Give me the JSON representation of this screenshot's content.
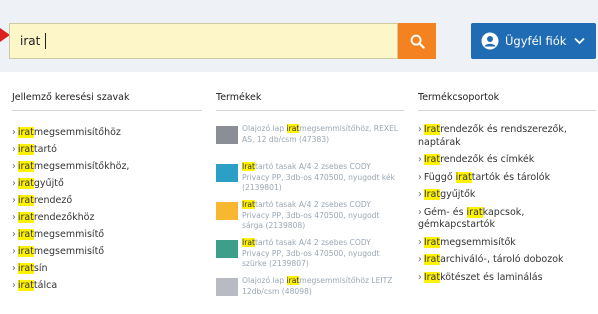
{
  "header": {
    "search_value": "irat",
    "account_label": "Ügyfél fiók",
    "colors": {
      "search_bg": "#fdf6c8",
      "search_button": "#f58220",
      "account_button": "#1f6cb5",
      "highlight": "#fff200"
    }
  },
  "columns": {
    "keywords_title": "Jellemző keresési szavak",
    "products_title": "Termékek",
    "categories_title": "Termékcsoportok"
  },
  "keywords": [
    {
      "pre": "›",
      "hl": "irat",
      "rest": "megsemmisítőhöz"
    },
    {
      "pre": "›",
      "hl": "irat",
      "rest": "tartó"
    },
    {
      "pre": "›",
      "hl": "irat",
      "rest": "megsemmisítőkhöz,"
    },
    {
      "pre": "›",
      "hl": "irat",
      "rest": "gyűjtő"
    },
    {
      "pre": "›",
      "hl": "irat",
      "rest": "rendező"
    },
    {
      "pre": "›",
      "hl": "irat",
      "rest": "rendezőkhöz"
    },
    {
      "pre": "›",
      "hl": "irat",
      "rest": "megsemmisítő"
    },
    {
      "pre": "›",
      "hl": "irat",
      "rest": "megsemmisítő"
    },
    {
      "pre": "›",
      "hl": "irat",
      "rest": "sín"
    },
    {
      "pre": "›",
      "hl": "irat",
      "rest": "tálca"
    }
  ],
  "products": [
    {
      "before": "Olajozó lap ",
      "hl": "irat",
      "after": "megsemmisítőhöz, REXEL AS, 12 db/csm (47383)",
      "thumb_color": "#8a8f96"
    },
    {
      "before": "",
      "hl": "Irat",
      "after": "tartó tasak A/4 2 zsebes CODY Privacy PP, 3db-os 470500, nyugodt kék (2139801)",
      "thumb_color": "#2c9fc7"
    },
    {
      "before": "",
      "hl": "Irat",
      "after": "tartó tasak A/4 2 zsebes CODY Privacy PP, 3db-os 470500, nyugodt sárga (2139808)",
      "thumb_color": "#f7b731"
    },
    {
      "before": "",
      "hl": "Irat",
      "after": "tartó tasak A/4 2 zsebes CODY Privacy PP, 3db-os 470500, nyugodt szürke (2139807)",
      "thumb_color": "#3d9f8a"
    },
    {
      "before": "Olajozó lap ",
      "hl": "irat",
      "after": "megsemmisítőhöz LEITZ 12db/csm (48098)",
      "thumb_color": "#b8bcc2"
    }
  ],
  "categories": [
    {
      "pre": "›",
      "before": "",
      "hl": "Irat",
      "after": "rendezők és rendszerezők, naptárak"
    },
    {
      "pre": "›",
      "before": "",
      "hl": "Irat",
      "after": "rendezők és címkék"
    },
    {
      "pre": "›",
      "before": "Függő ",
      "hl": "irat",
      "after": "tartók és tárolók"
    },
    {
      "pre": "›",
      "before": "",
      "hl": "Irat",
      "after": "gyűjtők"
    },
    {
      "pre": "›",
      "before": "Gém- és ",
      "hl": "irat",
      "after": "kapcsok, gémkapcstartók"
    },
    {
      "pre": "›",
      "before": "",
      "hl": "Irat",
      "after": "megsemmisítők"
    },
    {
      "pre": "›",
      "before": "",
      "hl": "Irat",
      "after": "archiváló-, tároló dobozok"
    },
    {
      "pre": "›",
      "before": "",
      "hl": "Irat",
      "after": "kötészet és laminálás"
    }
  ]
}
